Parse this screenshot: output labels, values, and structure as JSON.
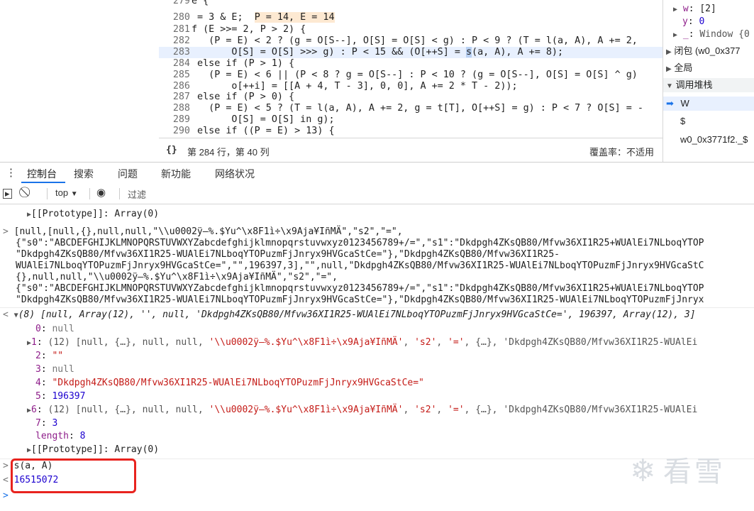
{
  "editor": {
    "lines": [
      {
        "num": "279",
        "code": "e {"
      },
      {
        "num": "280",
        "code": " = 3 & E;  ",
        "inline": "P = 14, E = 14"
      },
      {
        "num": "281",
        "code": "f (E >>= 2, P > 2) {"
      },
      {
        "num": "282",
        "code": "   (P = E) < 2 ? (g = O[S--], O[S] = O[S] < g) : P < 9 ? (T = l(a, A), A += 2,"
      },
      {
        "num": "283",
        "pre": "       O[S] = O[S] >>> g) : P < 15 && (O[++S] = ",
        "cursor": "s",
        "post": "(a, A), A += 8);"
      },
      {
        "num": "284",
        "code": " else if (P > 1) {"
      },
      {
        "num": "285",
        "code": "   (P = E) < 6 || (P < 8 ? g = O[S--] : P < 10 ? (g = O[S--], O[S] = O[S] ^ g)"
      },
      {
        "num": "286",
        "code": "       o[++i] = [[A + 4, T - 3], 0, 0], A += 2 * T - 2));"
      },
      {
        "num": "287",
        "code": " else if (P > 0) {"
      },
      {
        "num": "288",
        "code": "   (P = E) < 5 ? (T = l(a, A), A += 2, g = t[T], O[++S] = g) : P < 7 ? O[S] = -"
      },
      {
        "num": "289",
        "code": "       O[S] = O[S] in g);"
      },
      {
        "num": "290",
        "code": " else if ((P = E) > 13) {"
      }
    ],
    "status_braces": "{}",
    "status_position": "第 284 行，第 40 列",
    "status_coverage": "覆盖率：不适用"
  },
  "sidebar": {
    "w_label": "w",
    "w_value": "[2]",
    "y_label": "y",
    "y_value": "0",
    "underscore_label": "_",
    "underscore_value": "Window {0",
    "closure_label": "闭包 (w0_0x377",
    "global_label": "全局",
    "callstack_label": "调用堆栈",
    "frames": [
      "W",
      "$",
      "w0_0x3771f2._$"
    ]
  },
  "drawer": {
    "tabs": [
      "控制台",
      "搜索",
      "问题",
      "新功能",
      "网络状况"
    ]
  },
  "console_toolbar": {
    "context": "top",
    "filter_placeholder": "过滤"
  },
  "console": {
    "proto_line1": "[[Prototype]]: Array(0)",
    "log_l1": "[null,[null,{},null,null,\"\\\\u0002ÿ–%.$Yu^\\x8F1ì÷\\x9Aja¥IñMÄ\",\"s2\",\"=\",",
    "log_l2": "{\"s0\":\"ABCDEFGHIJKLMNOPQRSTUVWXYZabcdefghijklmnopqrstuvwxyz0123456789+/=\",\"s1\":\"Dkdpgh4ZKsQB80/Mfvw36XI1R25+WUAlEi7NLboqYTOP",
    "log_l3": "\"Dkdpgh4ZKsQB80/Mfvw36XI1R25-WUAlEi7NLboqYTOPuzmFjJnryx9HVGcaStCe=\"},\"Dkdpgh4ZKsQB80/Mfvw36XI1R25-",
    "log_l4": "WUAlEi7NLboqYTOPuzmFjJnryx9HVGcaStCe=\",\"\",196397,3],\"\",null,\"Dkdpgh4ZKsQB80/Mfvw36XI1R25-WUAlEi7NLboqYTOPuzmFjJnryx9HVGcaStC",
    "log_l5": "{},null,null,\"\\\\u0002ÿ–%.$Yu^\\x8F1ì÷\\x9Aja¥IñMÄ\",\"s2\",\"=\",",
    "log_l6": "{\"s0\":\"ABCDEFGHIJKLMNOPQRSTUVWXYZabcdefghijklmnopqrstuvwxyz0123456789+/=\",\"s1\":\"Dkdpgh4ZKsQB80/Mfvw36XI1R25+WUAlEi7NLboqYTOP",
    "log_l7": "\"Dkdpgh4ZKsQB80/Mfvw36XI1R25-WUAlEi7NLboqYTOPuzmFjJnryx9HVGcaStCe=\"},\"Dkdpgh4ZKsQB80/Mfvw36XI1R25-WUAlEi7NLboqYTOPuzmFjJnryx",
    "summary": "(8) [null, Array(12), '', null, 'Dkdpgh4ZKsQB80/Mfvw36XI1R25-WUAlEi7NLboqYTOPuzmFjJnryx9HVGcaStCe=', 196397, Array(12), 3]",
    "items": [
      {
        "key": "0",
        "value": "null",
        "kind": "null"
      },
      {
        "key": "1",
        "value": "(12) [null, {…}, null, null, '\\\\u0002ÿ–%.$Yu^\\x8F1ì÷\\x9Aja¥IñMÄ', 's2', '=', {…}, 'Dkdpgh4ZKsQB80/Mfvw36XI1R25-WUAlEi",
        "kind": "array"
      },
      {
        "key": "2",
        "value": "\"\"",
        "kind": "str"
      },
      {
        "key": "3",
        "value": "null",
        "kind": "null"
      },
      {
        "key": "4",
        "value": "\"Dkdpgh4ZKsQB80/Mfvw36XI1R25-WUAlEi7NLboqYTOPuzmFjJnryx9HVGcaStCe=\"",
        "kind": "str"
      },
      {
        "key": "5",
        "value": "196397",
        "kind": "num"
      },
      {
        "key": "6",
        "value": "(12) [null, {…}, null, null, '\\\\u0002ÿ–%.$Yu^\\x8F1ì÷\\x9Aja¥IñMÄ', 's2', '=', {…}, 'Dkdpgh4ZKsQB80/Mfvw36XI1R25-WUAlEi",
        "kind": "array"
      },
      {
        "key": "7",
        "value": "3",
        "kind": "num"
      }
    ],
    "length_key": "length",
    "length_value": "8",
    "proto_line2": "[[Prototype]]: Array(0)",
    "input": "s(a, A)",
    "result": "16515072"
  },
  "watermark": "看雪"
}
